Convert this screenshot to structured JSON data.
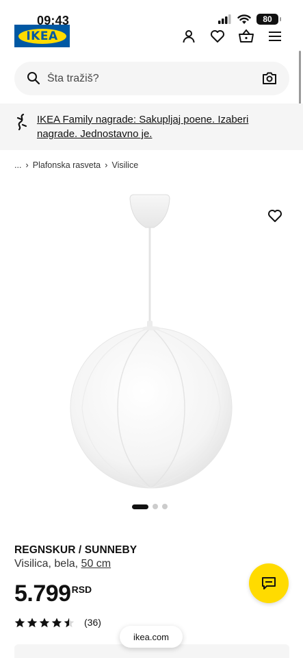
{
  "status_bar": {
    "time": "09:43",
    "battery": "80"
  },
  "header": {
    "logo_text": "IKEA",
    "brand_blue": "#0058a3",
    "brand_yellow": "#ffdb00"
  },
  "search": {
    "placeholder": "Šta tražiš?"
  },
  "family_banner": {
    "text": "IKEA Family nagrade: Sakupljaj poene. Izaberi nagrade. Jednostavno je."
  },
  "breadcrumb": {
    "ellipsis": "...",
    "items": [
      "Plafonska rasveta",
      "Visilice"
    ]
  },
  "product": {
    "name": "REGNSKUR / SUNNEBY",
    "description": "Visilica, bela,",
    "size": "50 cm",
    "price": "5.799",
    "currency": "RSD",
    "rating": 4.5,
    "rating_count": "(36)"
  },
  "carousel": {
    "total": 3,
    "active": 1
  },
  "browser": {
    "url": "ikea.com"
  }
}
